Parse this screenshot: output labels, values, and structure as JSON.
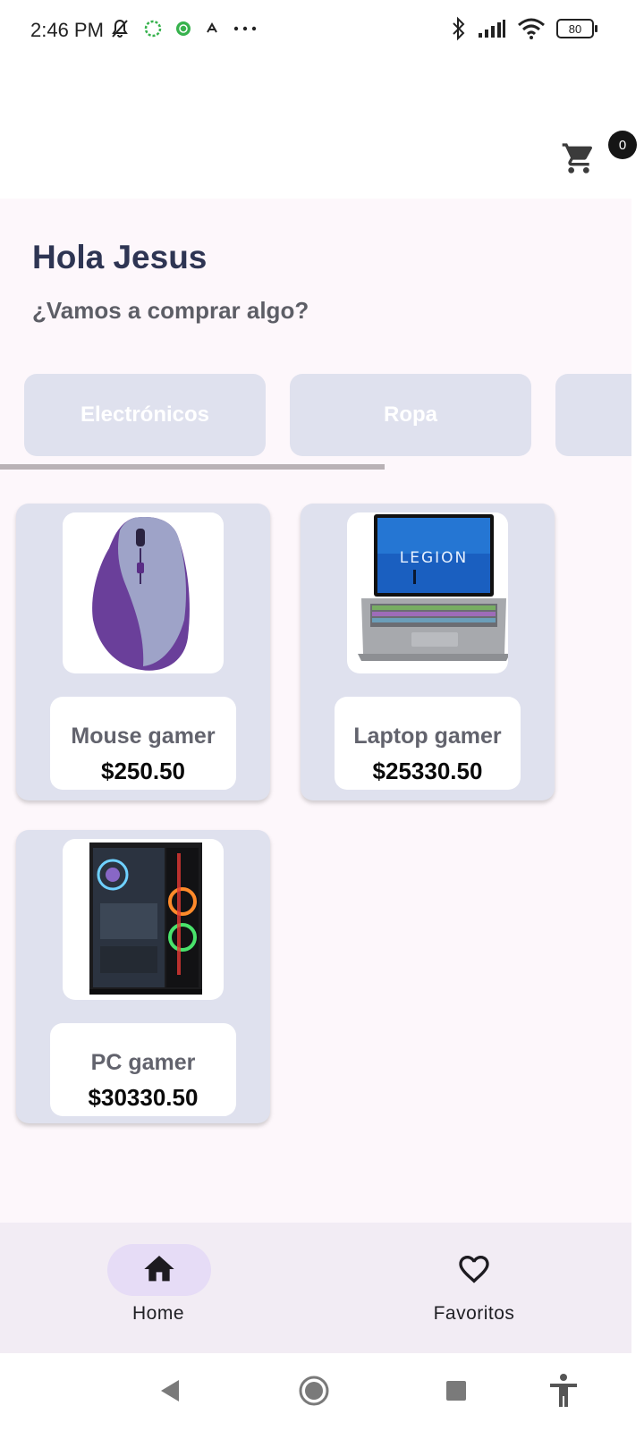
{
  "status_bar": {
    "time": "2:46 PM",
    "battery": "80",
    "icons": [
      "bell-off-icon",
      "loading-ring-icon",
      "app-notification-icon",
      "sync-icon",
      "more-dots-icon",
      "bluetooth-icon",
      "signal-icon",
      "wifi-icon",
      "battery-icon"
    ]
  },
  "header": {
    "cart_count": "0"
  },
  "main": {
    "greeting": "Hola Jesus",
    "subtitle": "¿Vamos a comprar algo?"
  },
  "categories": [
    {
      "label": "Electrónicos"
    },
    {
      "label": "Ropa"
    },
    {
      "label": ""
    }
  ],
  "products": [
    {
      "name": "Mouse gamer",
      "price": "$250.50",
      "image": "mouse-image"
    },
    {
      "name": "Laptop gamer",
      "price": "$25330.50",
      "image": "laptop-image"
    },
    {
      "name": "PC gamer",
      "price": "$30330.50",
      "image": "pc-case-image"
    }
  ],
  "bottom_nav": {
    "items": [
      {
        "label": "Home",
        "icon": "home-icon",
        "selected": true
      },
      {
        "label": "Favoritos",
        "icon": "heart-icon",
        "selected": false
      }
    ]
  },
  "colors": {
    "accent_text": "#2e3553",
    "card_bg": "#dfe1ee",
    "nav_bg": "#f2ecf4",
    "selected_pill": "#e6dcf6"
  }
}
